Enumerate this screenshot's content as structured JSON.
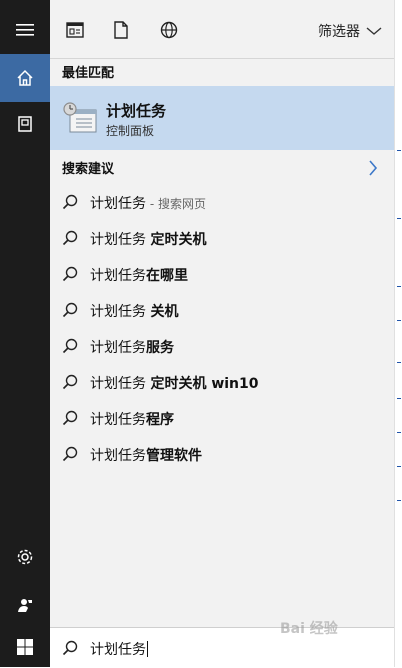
{
  "rail": {
    "items": [
      {
        "name": "menu-icon"
      },
      {
        "name": "home-icon"
      },
      {
        "name": "document-store-icon"
      },
      {
        "name": "settings-gear-icon"
      },
      {
        "name": "user-feedback-icon"
      },
      {
        "name": "windows-start-icon"
      }
    ],
    "active_color": "#3c6aa3"
  },
  "topbar": {
    "filter_label": "筛选器"
  },
  "best_match": {
    "header": "最佳匹配",
    "title": "计划任务",
    "subtitle": "控制面板",
    "highlight_color": "#c5d9ef"
  },
  "suggestions": {
    "header": "搜索建议",
    "items": [
      {
        "prefix": "计划任务",
        "bold": "",
        "hint": " - 搜索网页"
      },
      {
        "prefix": "计划任务 ",
        "bold": "定时关机",
        "hint": ""
      },
      {
        "prefix": "计划任务",
        "bold": "在哪里",
        "hint": ""
      },
      {
        "prefix": "计划任务 ",
        "bold": "关机",
        "hint": ""
      },
      {
        "prefix": "计划任务",
        "bold": "服务",
        "hint": ""
      },
      {
        "prefix": "计划任务 ",
        "bold": "定时关机 win10",
        "hint": ""
      },
      {
        "prefix": "计划任务",
        "bold": "程序",
        "hint": ""
      },
      {
        "prefix": "计划任务",
        "bold": "管理软件",
        "hint": ""
      }
    ]
  },
  "search": {
    "query": "计划任务"
  },
  "watermark": "Bai 经验"
}
